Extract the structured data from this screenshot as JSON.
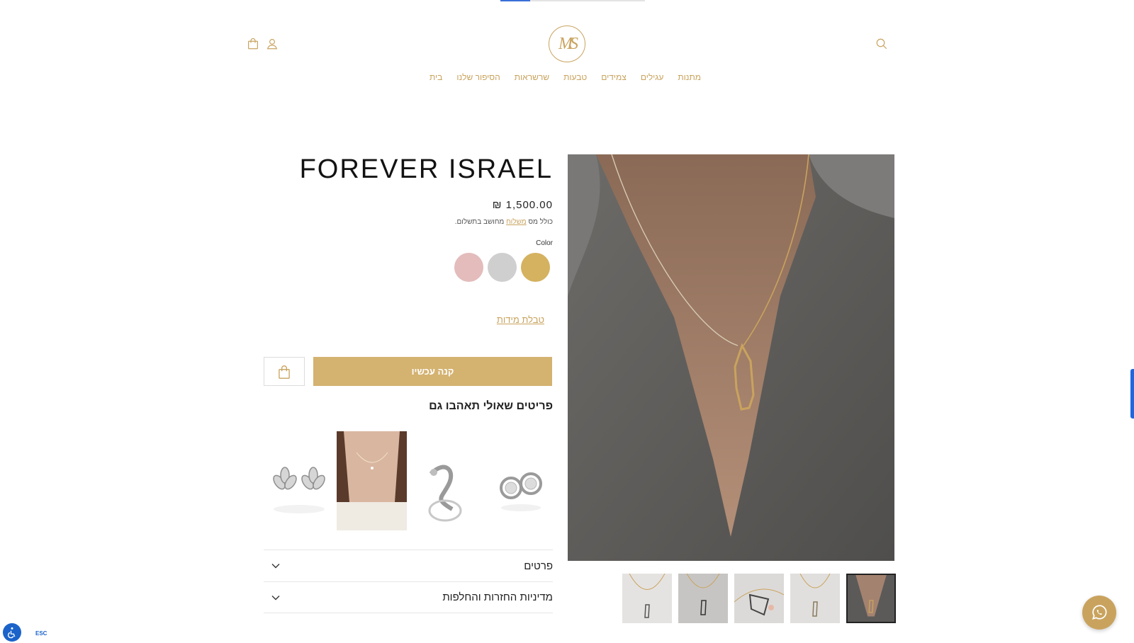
{
  "header": {
    "logo_text": "MS",
    "nav": [
      "בית",
      "הסיפור שלנו",
      "שרשראות",
      "טבעות",
      "צמידים",
      "עגילים",
      "מתנות"
    ]
  },
  "product": {
    "title": "FOREVER ISRAEL",
    "price": "₪ 1,500.00",
    "tax_prefix": "כולל מס",
    "tax_link": "משלוח",
    "tax_suffix": "מחושב בתשלום.",
    "color_label": "Color",
    "colors": [
      {
        "name": "gold",
        "hex": "#d4b260"
      },
      {
        "name": "silver",
        "hex": "#cfcfcf"
      },
      {
        "name": "rose",
        "hex": "#e3bcbb"
      }
    ],
    "size_chart": "טבלת מידות",
    "buy_now": "קנה עכשיו"
  },
  "related": {
    "title": "פריטים שאולי תאהבו גם"
  },
  "accordion": {
    "details": "פרטים",
    "returns": "מדיניות החזרות והחלפות"
  },
  "accessibility": {
    "esc": "ESC"
  },
  "theme": {
    "accent": "#c9a35e",
    "button": "#d4b270"
  }
}
